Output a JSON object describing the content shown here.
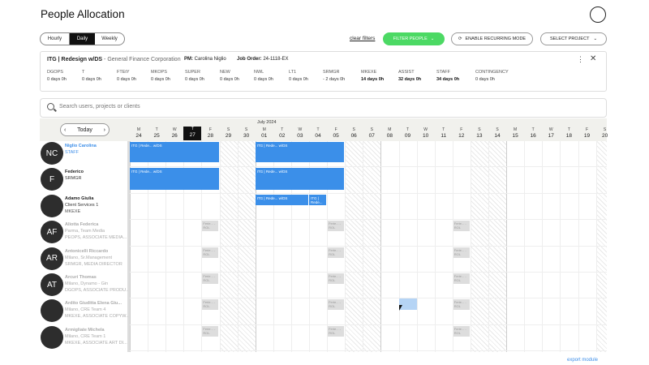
{
  "title": "People Allocation",
  "view_modes": [
    "Hourly",
    "Daily",
    "Weekly"
  ],
  "clear_filters": "clear filters",
  "filter_people": "FILTER PEOPLE",
  "recurring": "ENABLE RECURRING MODE",
  "select_project": "SELECT PROJECT",
  "project": {
    "name": "ITG | Redesign w/DS",
    "client": "- General Finance Corporation",
    "pm_label": "PM:",
    "pm": "Carolina Niglio",
    "jo_label": "Job Order:",
    "jo": "24-1118-EX",
    "roles": [
      {
        "k": "DGOPS",
        "v": "0 days 0h",
        "bold": false
      },
      {
        "k": "T",
        "v": "0 days 0h",
        "bold": false
      },
      {
        "k": "FTEtY",
        "v": "0 days 0h",
        "bold": false
      },
      {
        "k": "MKOPS",
        "v": "0 days 0h",
        "bold": false
      },
      {
        "k": "SUPER",
        "v": "0 days 0h",
        "bold": false
      },
      {
        "k": "NEW",
        "v": "0 days 0h",
        "bold": false
      },
      {
        "k": "NWL",
        "v": "0 days 0h",
        "bold": false
      },
      {
        "k": "LT1",
        "v": "0 days 0h",
        "bold": false
      },
      {
        "k": "SRMGR",
        "v": "- 2 days 0h",
        "bold": false
      },
      {
        "k": "MKEXE",
        "v": "14 days 0h",
        "bold": true
      },
      {
        "k": "ASSIST",
        "v": "32 days 0h",
        "bold": true
      },
      {
        "k": "STAFF",
        "v": "34 days 0h",
        "bold": true
      },
      {
        "k": "CONTINGENCY",
        "v": "0 days 0h",
        "bold": false
      }
    ]
  },
  "search_placeholder": "Search users, projects or clients",
  "month": "July 2024",
  "today": "Today",
  "days": [
    {
      "w": "M",
      "n": "24"
    },
    {
      "w": "T",
      "n": "25"
    },
    {
      "w": "W",
      "n": "26"
    },
    {
      "w": "T",
      "n": "27"
    },
    {
      "w": "F",
      "n": "28"
    },
    {
      "w": "S",
      "n": "29"
    },
    {
      "w": "S",
      "n": "30"
    },
    {
      "w": "M",
      "n": "01"
    },
    {
      "w": "T",
      "n": "02"
    },
    {
      "w": "W",
      "n": "03"
    },
    {
      "w": "T",
      "n": "04"
    },
    {
      "w": "F",
      "n": "05"
    },
    {
      "w": "S",
      "n": "06"
    },
    {
      "w": "S",
      "n": "07"
    },
    {
      "w": "M",
      "n": "08"
    },
    {
      "w": "T",
      "n": "09"
    },
    {
      "w": "W",
      "n": "10"
    },
    {
      "w": "T",
      "n": "11"
    },
    {
      "w": "F",
      "n": "12"
    },
    {
      "w": "S",
      "n": "13"
    },
    {
      "w": "S",
      "n": "14"
    },
    {
      "w": "M",
      "n": "15"
    },
    {
      "w": "T",
      "n": "16"
    },
    {
      "w": "W",
      "n": "17"
    },
    {
      "w": "T",
      "n": "18"
    },
    {
      "w": "F",
      "n": "19"
    },
    {
      "w": "S",
      "n": "20"
    }
  ],
  "people": [
    {
      "init": "NC",
      "name": "Niglio Carolina",
      "l1": "STAFF",
      "l2": "",
      "style": "blue"
    },
    {
      "init": "F",
      "name": "Federico",
      "l1": "SRMGR",
      "l2": "",
      "style": ""
    },
    {
      "init": "",
      "name": "Adamo Giulia",
      "l1": "Client Services 1",
      "l2": "MKEXE",
      "style": ""
    },
    {
      "init": "AF",
      "name": "Aliotta Federica",
      "l1": "Parma, Team Media",
      "l2": "PEOPS, ASSOCIATE MEDIA...",
      "style": "dim"
    },
    {
      "init": "AR",
      "name": "Antonicelli Riccardo",
      "l1": "Milano, Sr.Management",
      "l2": "SRMGR, MEDIA DIRECTOR",
      "style": "dim"
    },
    {
      "init": "AT",
      "name": "Arcuri Thomas",
      "l1": "Milano, Dynamo - Gin",
      "l2": "DGOPS, ASSOCIATE PRODU...",
      "style": "dim"
    },
    {
      "init": "",
      "name": "Ardito Giuditta Elena Giu...",
      "l1": "Milano, CRE Team 4",
      "l2": "MKEXE, ASSOCIATE COPYW...",
      "style": "dim"
    },
    {
      "init": "",
      "name": "Armigliate Michela",
      "l1": "Milano, CRE Team 1",
      "l2": "MKEXE, ASSOCIATE ART DI...",
      "style": "dim"
    }
  ],
  "bar_label": "ITG | Rede... w/DS",
  "ghost_label": "Ferie... - ROL",
  "export": "export module"
}
